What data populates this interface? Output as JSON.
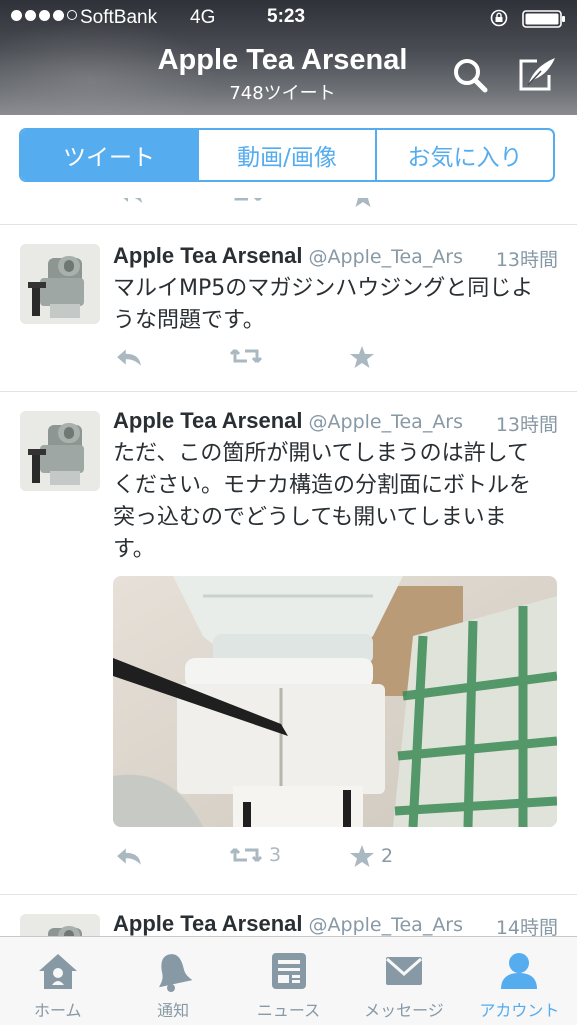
{
  "status_bar": {
    "carrier": "SoftBank",
    "network": "4G",
    "time": "5:23"
  },
  "header": {
    "title": "Apple Tea Arsenal",
    "subtitle": "748ツイート"
  },
  "segments": [
    {
      "label": "ツイート",
      "active": true
    },
    {
      "label": "動画/画像",
      "active": false
    },
    {
      "label": "お気に入り",
      "active": false
    }
  ],
  "tweets": [
    {
      "name": "Apple Tea Arsenal",
      "handle": "@Apple_Tea_Ars",
      "time": "13時間",
      "lines": [
        "マルイMP5のマガジンハウジングと同じよ",
        "うな問題です。"
      ]
    },
    {
      "name": "Apple Tea Arsenal",
      "handle": "@Apple_Tea_Ars",
      "time": "13時間",
      "lines": [
        "ただ、この箇所が開いてしまうのは許して",
        "ください。モナカ構造の分割面にボトルを",
        "突っ込むのでどうしても開いてしまいま",
        "す。"
      ],
      "retweets": "3",
      "favorites": "2"
    },
    {
      "name": "Apple Tea Arsenal",
      "handle": "@Apple_Tea_Ars",
      "time": "14時間"
    }
  ],
  "tabbar": [
    {
      "label": "ホーム",
      "icon": "home-icon",
      "active": false
    },
    {
      "label": "通知",
      "icon": "bell-icon",
      "active": false
    },
    {
      "label": "ニュース",
      "icon": "news-icon",
      "active": false
    },
    {
      "label": "メッセージ",
      "icon": "envelope-icon",
      "active": false
    },
    {
      "label": "アカウント",
      "icon": "person-icon",
      "active": true
    }
  ],
  "colors": {
    "accent": "#55acee",
    "text": "#292f33",
    "muted": "#8899a6",
    "action": "#aab8c2"
  }
}
